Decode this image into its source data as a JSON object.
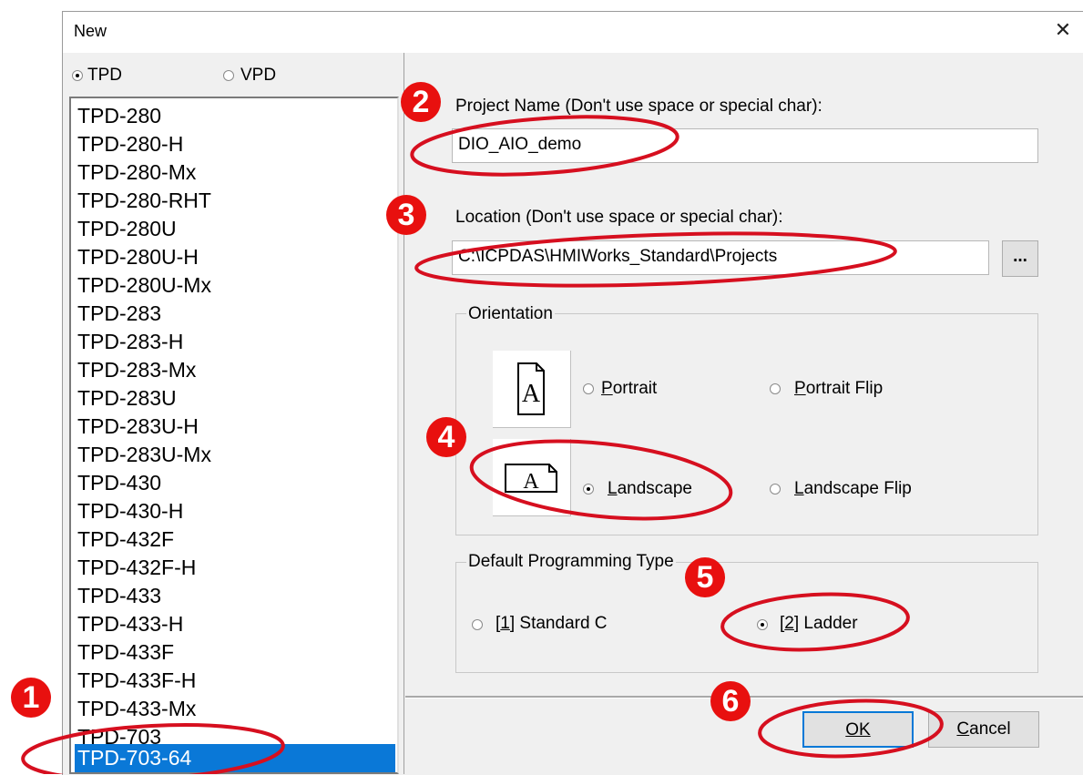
{
  "window": {
    "title": "New",
    "close_glyph": "✕"
  },
  "device_type": {
    "options": [
      {
        "label": "TPD",
        "checked": true
      },
      {
        "label": "VPD",
        "checked": false
      }
    ]
  },
  "models": [
    "TPD-280",
    "TPD-280-H",
    "TPD-280-Mx",
    "TPD-280-RHT",
    "TPD-280U",
    "TPD-280U-H",
    "TPD-280U-Mx",
    "TPD-283",
    "TPD-283-H",
    "TPD-283-Mx",
    "TPD-283U",
    "TPD-283U-H",
    "TPD-283U-Mx",
    "TPD-430",
    "TPD-430-H",
    "TPD-432F",
    "TPD-432F-H",
    "TPD-433",
    "TPD-433-H",
    "TPD-433F",
    "TPD-433F-H",
    "TPD-433-Mx",
    "TPD-703",
    "TPD-703-64"
  ],
  "selected_model": "TPD-703-64",
  "project_name": {
    "label": "Project Name (Don't use space or special char):",
    "value": "DIO_AIO_demo"
  },
  "location": {
    "label": "Location (Don't use space or special char):",
    "value": "C:\\ICPDAS\\HMIWorks_Standard\\Projects",
    "browse_label": "..."
  },
  "orientation": {
    "legend": "Orientation",
    "icon_letter": "A",
    "options": [
      {
        "label": "Portrait",
        "checked": false
      },
      {
        "label": "Portrait Flip",
        "checked": false
      },
      {
        "label": "Landscape",
        "checked": true
      },
      {
        "label": "Landscape Flip",
        "checked": false
      }
    ]
  },
  "programming": {
    "legend": "Default Programming Type",
    "options": [
      {
        "label": "[1] Standard C",
        "checked": false
      },
      {
        "label": "[2] Ladder",
        "checked": true
      }
    ]
  },
  "buttons": {
    "ok": "OK",
    "cancel": "Cancel"
  },
  "steps": [
    "1",
    "2",
    "3",
    "4",
    "5",
    "6"
  ],
  "colors": {
    "selection": "#0a78d7",
    "annotation": "#d60f1f"
  }
}
